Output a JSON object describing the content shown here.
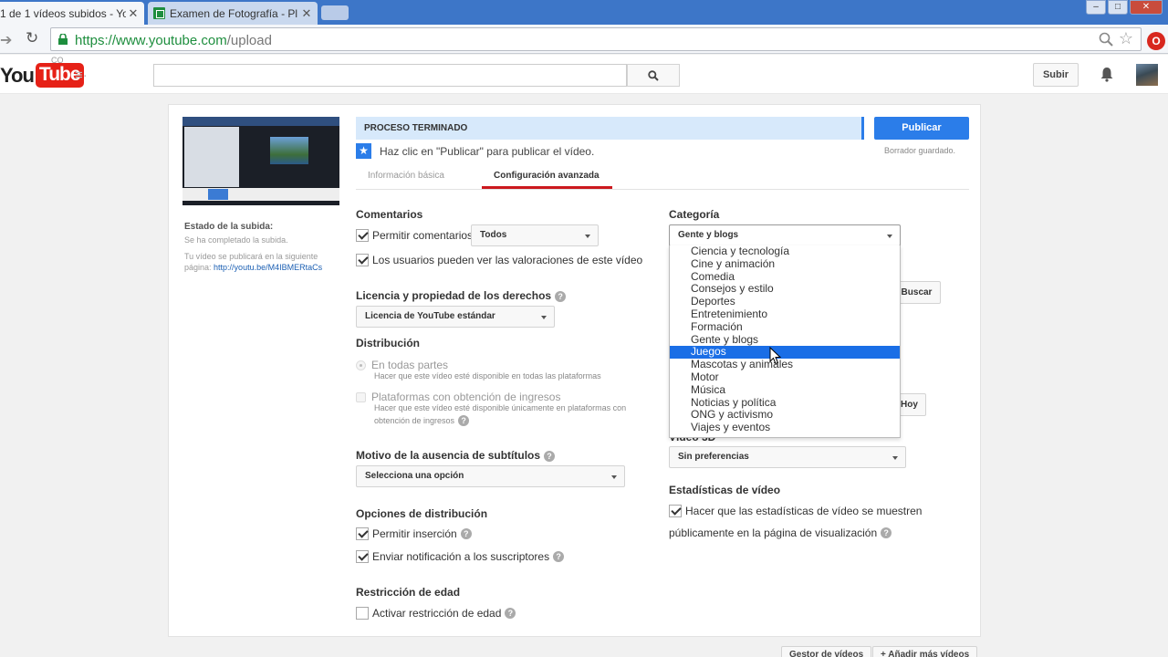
{
  "browser": {
    "tabs": [
      {
        "title": "1 de 1 vídeos subidos - Yo"
      },
      {
        "title": "Examen de Fotografía - Pl"
      }
    ],
    "url_host": "https://www.youtube.com",
    "url_path": "/upload"
  },
  "masthead": {
    "logo_you": "You",
    "logo_tube": "Tube",
    "logo_country": "CO",
    "search_placeholder": "",
    "upload_label": "Subir"
  },
  "upload": {
    "progress_label": "PROCESO TERMINADO",
    "publish_label": "Publicar",
    "draft_saved": "Borrador guardado.",
    "hint": "Haz clic en \"Publicar\" para publicar el vídeo.",
    "status_label": "Estado de la subida:",
    "status_text": "Se ha completado la subida.",
    "publish_note": "Tu vídeo se publicará en la siguiente página:",
    "video_link": "http://youtu.be/M4IBMERtaCs",
    "tabs": {
      "basic": "Información básica",
      "advanced": "Configuración avanzada"
    }
  },
  "comments": {
    "title": "Comentarios",
    "allow_label": "Permitir comentarios",
    "allow_checked": true,
    "allow_option": "Todos",
    "ratings_label": "Los usuarios pueden ver las valoraciones de este vídeo",
    "ratings_checked": true
  },
  "license": {
    "title": "Licencia y propiedad de los derechos",
    "value": "Licencia de YouTube estándar"
  },
  "distribution": {
    "title": "Distribución",
    "everywhere_label": "En todas partes",
    "everywhere_desc": "Hacer que este vídeo esté disponible en todas las plataformas",
    "monetized_label": "Plataformas con obtención de ingresos",
    "monetized_desc": "Hacer que este vídeo esté disponible únicamente en plataformas con obtención de ingresos"
  },
  "subtitles": {
    "title": "Motivo de la ausencia de subtítulos",
    "value": "Selecciona una opción"
  },
  "distribution_options": {
    "title": "Opciones de distribución",
    "embed_label": "Permitir inserción",
    "embed_checked": true,
    "notify_label": "Enviar notificación a los suscriptores",
    "notify_checked": true
  },
  "age": {
    "title": "Restricción de edad",
    "restrict_label": "Activar restricción de edad",
    "restrict_checked": false
  },
  "category": {
    "title": "Categoría",
    "selected": "Gente y blogs",
    "highlighted": "Juegos",
    "options": [
      "Ciencia y tecnología",
      "Cine y animación",
      "Comedia",
      "Consejos y estilo",
      "Deportes",
      "Entretenimiento",
      "Formación",
      "Gente y blogs",
      "Juegos",
      "Mascotas y animales",
      "Motor",
      "Música",
      "Noticias y política",
      "ONG y activismo",
      "Viajes y eventos"
    ]
  },
  "right_side": {
    "search_btn": "Buscar",
    "today_btn": "Hoy",
    "video3d_label": "Vídeo 3D",
    "video3d_value": "Sin preferencias",
    "stats_title": "Estadísticas de vídeo",
    "stats_label_1": "Hacer que las estadísticas de vídeo se muestren",
    "stats_label_2": "públicamente en la página de visualización",
    "stats_checked": true
  },
  "bottom": {
    "manager_btn": "Gestor de vídeos",
    "add_more_btn": "+ Añadir más vídeos"
  }
}
